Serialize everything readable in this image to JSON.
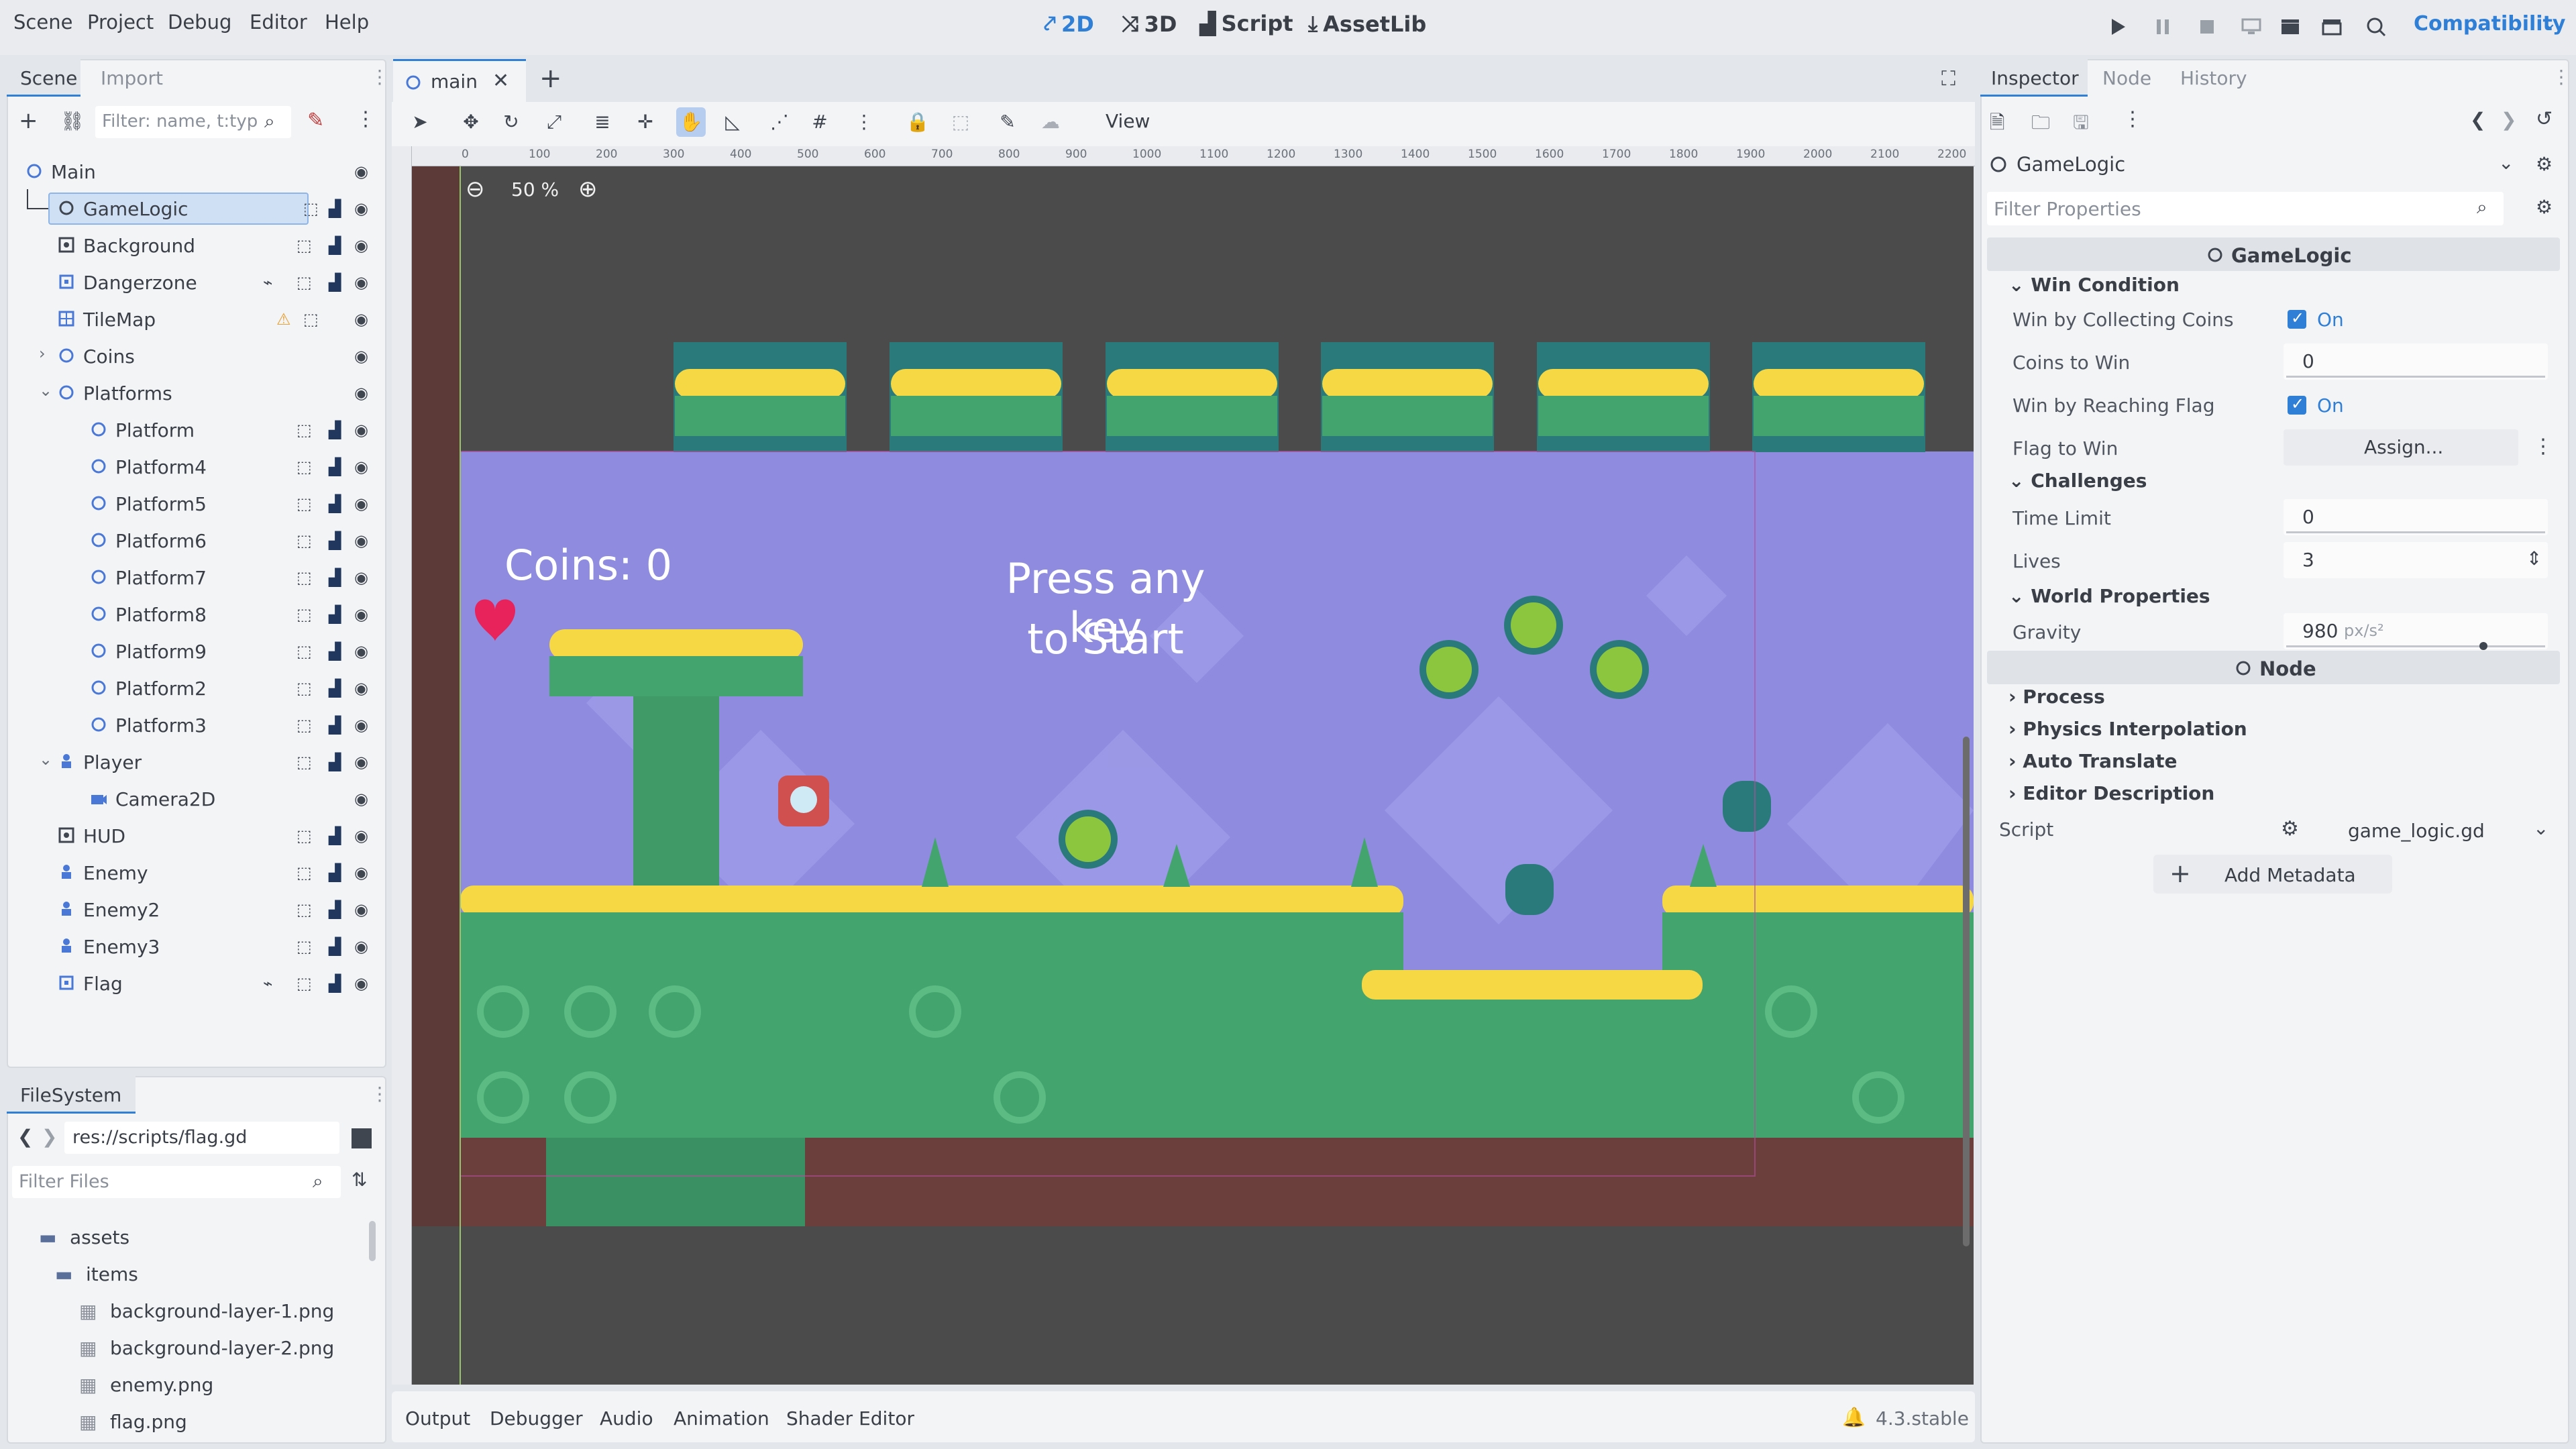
{
  "menu": [
    "Scene",
    "Project",
    "Debug",
    "Editor",
    "Help"
  ],
  "workspaces": {
    "w2d": "2D",
    "w3d": "3D",
    "script": "Script",
    "assetlib": "AssetLib"
  },
  "renderer": "Compatibility",
  "scene_dock": {
    "tabs": {
      "scene": "Scene",
      "import": "Import"
    },
    "filter_placeholder": "Filter: name, t:typ",
    "nodes": [
      {
        "label": "Main",
        "icon": "node2d-icon",
        "indent": 0
      },
      {
        "label": "GameLogic",
        "icon": "node-icon",
        "indent": 1,
        "selected": true
      },
      {
        "label": "Background",
        "icon": "parallax-icon",
        "indent": 1
      },
      {
        "label": "Dangerzone",
        "icon": "area2d-icon",
        "indent": 1
      },
      {
        "label": "TileMap",
        "icon": "tilemap-icon",
        "indent": 1,
        "warning": true
      },
      {
        "label": "Coins",
        "icon": "node2d-icon",
        "indent": 1,
        "collapsed": true
      },
      {
        "label": "Platforms",
        "icon": "node2d-icon",
        "indent": 1,
        "expanded": true
      },
      {
        "label": "Platform",
        "icon": "node2d-icon",
        "indent": 2
      },
      {
        "label": "Platform4",
        "icon": "node2d-icon",
        "indent": 2
      },
      {
        "label": "Platform5",
        "icon": "node2d-icon",
        "indent": 2
      },
      {
        "label": "Platform6",
        "icon": "node2d-icon",
        "indent": 2
      },
      {
        "label": "Platform7",
        "icon": "node2d-icon",
        "indent": 2
      },
      {
        "label": "Platform8",
        "icon": "node2d-icon",
        "indent": 2
      },
      {
        "label": "Platform9",
        "icon": "node2d-icon",
        "indent": 2
      },
      {
        "label": "Platform2",
        "icon": "node2d-icon",
        "indent": 2
      },
      {
        "label": "Platform3",
        "icon": "node2d-icon",
        "indent": 2
      },
      {
        "label": "Player",
        "icon": "character-icon",
        "indent": 1,
        "expanded": true
      },
      {
        "label": "Camera2D",
        "icon": "camera-icon",
        "indent": 2
      },
      {
        "label": "HUD",
        "icon": "canvaslayer-icon",
        "indent": 1
      },
      {
        "label": "Enemy",
        "icon": "character-icon",
        "indent": 1
      },
      {
        "label": "Enemy2",
        "icon": "character-icon",
        "indent": 1
      },
      {
        "label": "Enemy3",
        "icon": "character-icon",
        "indent": 1
      },
      {
        "label": "Flag",
        "icon": "area2d-icon",
        "indent": 1
      }
    ]
  },
  "filesystem": {
    "tab": "FileSystem",
    "path": "res://scripts/flag.gd",
    "filter_placeholder": "Filter Files",
    "items": [
      {
        "label": "assets",
        "type": "folder",
        "open": true
      },
      {
        "label": "items",
        "type": "folder"
      },
      {
        "label": "background-layer-1.png",
        "type": "file"
      },
      {
        "label": "background-layer-2.png",
        "type": "file"
      },
      {
        "label": "enemy.png",
        "type": "file"
      },
      {
        "label": "flag.png",
        "type": "file"
      }
    ]
  },
  "viewport": {
    "tab_label": "main",
    "zoom": "50 %",
    "view_menu": "View",
    "ruler_ticks": [
      "0",
      "100",
      "200",
      "300",
      "400",
      "500",
      "600",
      "700",
      "800",
      "900",
      "1000",
      "1100",
      "1200",
      "1300",
      "1400",
      "1500",
      "1600",
      "1700",
      "1800",
      "1900",
      "2000",
      "2100",
      "2200"
    ],
    "game_coins_text": "Coins: 0",
    "game_press_line1": "Press any key",
    "game_press_line2": "to Start"
  },
  "inspector": {
    "tabs": {
      "inspector": "Inspector",
      "node": "Node",
      "history": "History"
    },
    "object_name": "GameLogic",
    "filter_placeholder": "Filter Properties",
    "header_class": "GameLogic",
    "sections": {
      "win": "Win Condition",
      "challenges": "Challenges",
      "world": "World Properties"
    },
    "props": {
      "win_coins_label": "Win by Collecting Coins",
      "win_coins_value": "On",
      "coins_to_win_label": "Coins to Win",
      "coins_to_win_value": "0",
      "win_flag_label": "Win by Reaching Flag",
      "win_flag_value": "On",
      "flag_to_win_label": "Flag to Win",
      "flag_to_win_value": "Assign...",
      "time_limit_label": "Time Limit",
      "time_limit_value": "0",
      "lives_label": "Lives",
      "lives_value": "3",
      "gravity_label": "Gravity",
      "gravity_value": "980",
      "gravity_unit": "px/s²"
    },
    "node_header": "Node",
    "node_sections": [
      "Process",
      "Physics Interpolation",
      "Auto Translate",
      "Editor Description"
    ],
    "script_label": "Script",
    "script_value": "game_logic.gd",
    "add_metadata": "Add Metadata"
  },
  "bottom_panel": {
    "tabs": [
      "Output",
      "Debugger",
      "Audio",
      "Animation",
      "Shader Editor"
    ],
    "version": "4.3.stable"
  },
  "colors": {
    "accent": "#2f7fd7",
    "node_blue": "#4a78d6",
    "sky": "#8f8ce0",
    "grass": "#43a46e",
    "dirt": "#6b3f3b",
    "gold": "#f6d844",
    "editor_bg": "#4b4b4b"
  }
}
